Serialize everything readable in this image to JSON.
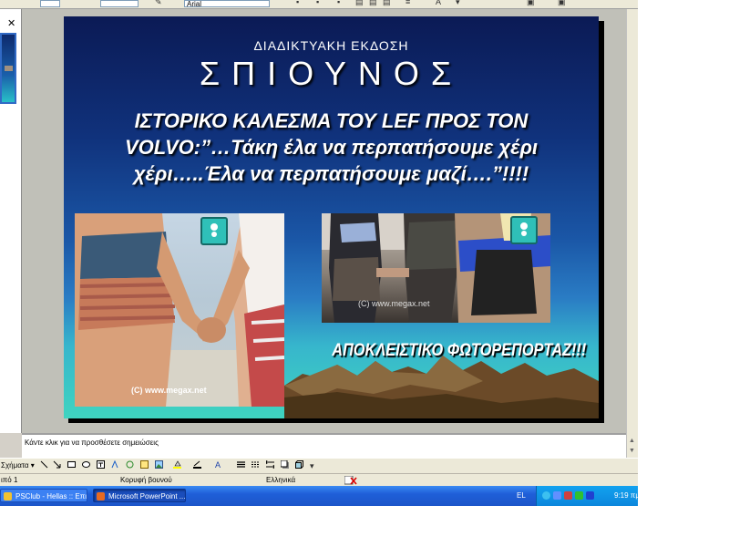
{
  "toolbar": {
    "font_name_value": "Arial"
  },
  "slide": {
    "subtitle": "ΔΙΑΔΙΚΤΥΑΚΗ ΕΚΔΟΣΗ",
    "title": "ΣΠΙΟΥΝΟΣ",
    "headline_lines": [
      "ΙΣΤΟΡΙΚΟ ΚΑΛΕΣΜΑ ΤΟΥ LEF ΠΡΟΣ ΤΟΝ",
      "VOLVO:”…Τάκη έλα να περπατήσουμε χέρι",
      "χέρι…..Έλα να περπατήσουμε μαζί….”!!!!"
    ],
    "photo1_watermark": "(C) www.megax.net",
    "photo2_watermark": "(C) www.megax.net",
    "report_text": "ΑΠΟΚΛΕΙΣΤΙΚΟ ΦΩΤΟΡΕΠΟΡΤΑΖ!!!"
  },
  "notes": {
    "placeholder": "Κάντε κλικ για να προσθέσετε σημειώσεις"
  },
  "drawing_toolbar": {
    "label": "Σχήματα"
  },
  "status_bar": {
    "slide_indicator": "ιπό 1",
    "design": "Κορυφή βουνού",
    "language": "Ελληνικά"
  },
  "taskbar": {
    "buttons": [
      {
        "label": "PSClub - Hellas :: Επι..."
      },
      {
        "label": "Microsoft PowerPoint ..."
      }
    ],
    "language": "EL",
    "clock": "9:19 πμ"
  },
  "colors": {
    "taskbar_blue": "#1f5fd8",
    "slide_navy": "#0b1a55",
    "slide_cyan": "#3fd4c0"
  }
}
